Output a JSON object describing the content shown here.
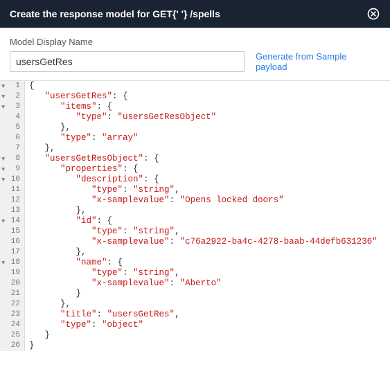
{
  "header": {
    "title": "Create the response model for GET{' '} /spells"
  },
  "form": {
    "label": "Model Display Name",
    "input_value": "usersGetRes",
    "generate_link": "Generate from Sample payload"
  },
  "editor": {
    "lines": [
      {
        "n": 1,
        "fold": true,
        "code": [
          {
            "t": "{",
            "c": "p"
          }
        ]
      },
      {
        "n": 2,
        "fold": true,
        "code": [
          {
            "t": "   ",
            "c": "p"
          },
          {
            "t": "\"usersGetRes\"",
            "c": "k"
          },
          {
            "t": ": {",
            "c": "p"
          }
        ]
      },
      {
        "n": 3,
        "fold": true,
        "code": [
          {
            "t": "      ",
            "c": "p"
          },
          {
            "t": "\"items\"",
            "c": "k"
          },
          {
            "t": ": {",
            "c": "p"
          }
        ]
      },
      {
        "n": 4,
        "fold": false,
        "code": [
          {
            "t": "         ",
            "c": "p"
          },
          {
            "t": "\"type\"",
            "c": "k"
          },
          {
            "t": ": ",
            "c": "p"
          },
          {
            "t": "\"usersGetResObject\"",
            "c": "s"
          }
        ]
      },
      {
        "n": 5,
        "fold": false,
        "code": [
          {
            "t": "      },",
            "c": "p"
          }
        ]
      },
      {
        "n": 6,
        "fold": false,
        "code": [
          {
            "t": "      ",
            "c": "p"
          },
          {
            "t": "\"type\"",
            "c": "k"
          },
          {
            "t": ": ",
            "c": "p"
          },
          {
            "t": "\"array\"",
            "c": "s"
          }
        ]
      },
      {
        "n": 7,
        "fold": false,
        "code": [
          {
            "t": "   },",
            "c": "p"
          }
        ]
      },
      {
        "n": 8,
        "fold": true,
        "code": [
          {
            "t": "   ",
            "c": "p"
          },
          {
            "t": "\"usersGetResObject\"",
            "c": "k"
          },
          {
            "t": ": {",
            "c": "p"
          }
        ]
      },
      {
        "n": 9,
        "fold": true,
        "code": [
          {
            "t": "      ",
            "c": "p"
          },
          {
            "t": "\"properties\"",
            "c": "k"
          },
          {
            "t": ": {",
            "c": "p"
          }
        ]
      },
      {
        "n": 10,
        "fold": true,
        "code": [
          {
            "t": "         ",
            "c": "p"
          },
          {
            "t": "\"description\"",
            "c": "k"
          },
          {
            "t": ": {",
            "c": "p"
          }
        ]
      },
      {
        "n": 11,
        "fold": false,
        "code": [
          {
            "t": "            ",
            "c": "p"
          },
          {
            "t": "\"type\"",
            "c": "k"
          },
          {
            "t": ": ",
            "c": "p"
          },
          {
            "t": "\"string\"",
            "c": "s"
          },
          {
            "t": ",",
            "c": "p"
          }
        ]
      },
      {
        "n": 12,
        "fold": false,
        "code": [
          {
            "t": "            ",
            "c": "p"
          },
          {
            "t": "\"x-samplevalue\"",
            "c": "k"
          },
          {
            "t": ": ",
            "c": "p"
          },
          {
            "t": "\"Opens locked doors\"",
            "c": "s"
          }
        ]
      },
      {
        "n": 13,
        "fold": false,
        "code": [
          {
            "t": "         },",
            "c": "p"
          }
        ]
      },
      {
        "n": 14,
        "fold": true,
        "code": [
          {
            "t": "         ",
            "c": "p"
          },
          {
            "t": "\"id\"",
            "c": "k"
          },
          {
            "t": ": {",
            "c": "p"
          }
        ]
      },
      {
        "n": 15,
        "fold": false,
        "code": [
          {
            "t": "            ",
            "c": "p"
          },
          {
            "t": "\"type\"",
            "c": "k"
          },
          {
            "t": ": ",
            "c": "p"
          },
          {
            "t": "\"string\"",
            "c": "s"
          },
          {
            "t": ",",
            "c": "p"
          }
        ]
      },
      {
        "n": 16,
        "fold": false,
        "code": [
          {
            "t": "            ",
            "c": "p"
          },
          {
            "t": "\"x-samplevalue\"",
            "c": "k"
          },
          {
            "t": ": ",
            "c": "p"
          },
          {
            "t": "\"c76a2922-ba4c-4278-baab-44defb631236\"",
            "c": "s"
          }
        ]
      },
      {
        "n": 17,
        "fold": false,
        "code": [
          {
            "t": "         },",
            "c": "p"
          }
        ]
      },
      {
        "n": 18,
        "fold": true,
        "code": [
          {
            "t": "         ",
            "c": "p"
          },
          {
            "t": "\"name\"",
            "c": "k"
          },
          {
            "t": ": {",
            "c": "p"
          }
        ]
      },
      {
        "n": 19,
        "fold": false,
        "code": [
          {
            "t": "            ",
            "c": "p"
          },
          {
            "t": "\"type\"",
            "c": "k"
          },
          {
            "t": ": ",
            "c": "p"
          },
          {
            "t": "\"string\"",
            "c": "s"
          },
          {
            "t": ",",
            "c": "p"
          }
        ]
      },
      {
        "n": 20,
        "fold": false,
        "code": [
          {
            "t": "            ",
            "c": "p"
          },
          {
            "t": "\"x-samplevalue\"",
            "c": "k"
          },
          {
            "t": ": ",
            "c": "p"
          },
          {
            "t": "\"Aberto\"",
            "c": "s"
          }
        ]
      },
      {
        "n": 21,
        "fold": false,
        "code": [
          {
            "t": "         }",
            "c": "p"
          }
        ]
      },
      {
        "n": 22,
        "fold": false,
        "code": [
          {
            "t": "      },",
            "c": "p"
          }
        ]
      },
      {
        "n": 23,
        "fold": false,
        "code": [
          {
            "t": "      ",
            "c": "p"
          },
          {
            "t": "\"title\"",
            "c": "k"
          },
          {
            "t": ": ",
            "c": "p"
          },
          {
            "t": "\"usersGetRes\"",
            "c": "s"
          },
          {
            "t": ",",
            "c": "p"
          }
        ]
      },
      {
        "n": 24,
        "fold": false,
        "code": [
          {
            "t": "      ",
            "c": "p"
          },
          {
            "t": "\"type\"",
            "c": "k"
          },
          {
            "t": ": ",
            "c": "p"
          },
          {
            "t": "\"object\"",
            "c": "s"
          }
        ]
      },
      {
        "n": 25,
        "fold": false,
        "code": [
          {
            "t": "   }",
            "c": "p"
          }
        ]
      },
      {
        "n": 26,
        "fold": false,
        "code": [
          {
            "t": "}",
            "c": "p"
          }
        ]
      }
    ]
  }
}
